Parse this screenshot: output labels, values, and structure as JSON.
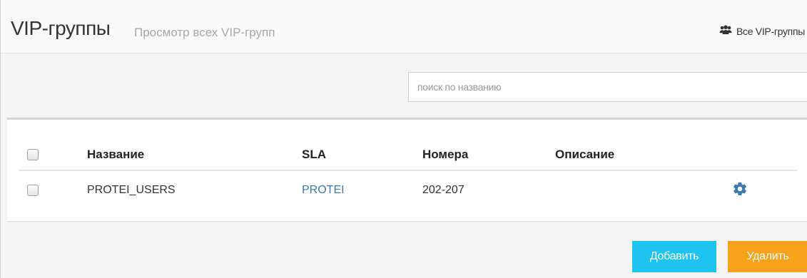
{
  "header": {
    "title": "VIP-группы",
    "subtitle": "Просмотр всех VIP-групп",
    "all_link": "Все VIP-группы",
    "all_link_icon": "users-icon"
  },
  "search": {
    "placeholder": "поиск по названию",
    "value": ""
  },
  "table": {
    "columns": [
      "Название",
      "SLA",
      "Номера",
      "Описание"
    ],
    "rows": [
      {
        "name": "PROTEI_USERS",
        "sla": "PROTEI",
        "numbers": "202-207",
        "description": "",
        "action_icon": "gear-icon"
      }
    ]
  },
  "actions": {
    "add_label": "Добавить",
    "delete_label": "Удалить"
  },
  "colors": {
    "link": "#3a79b3",
    "add_button": "#1ec3ef",
    "delete_button": "#f7a21b",
    "gear": "#3d7ab0"
  }
}
